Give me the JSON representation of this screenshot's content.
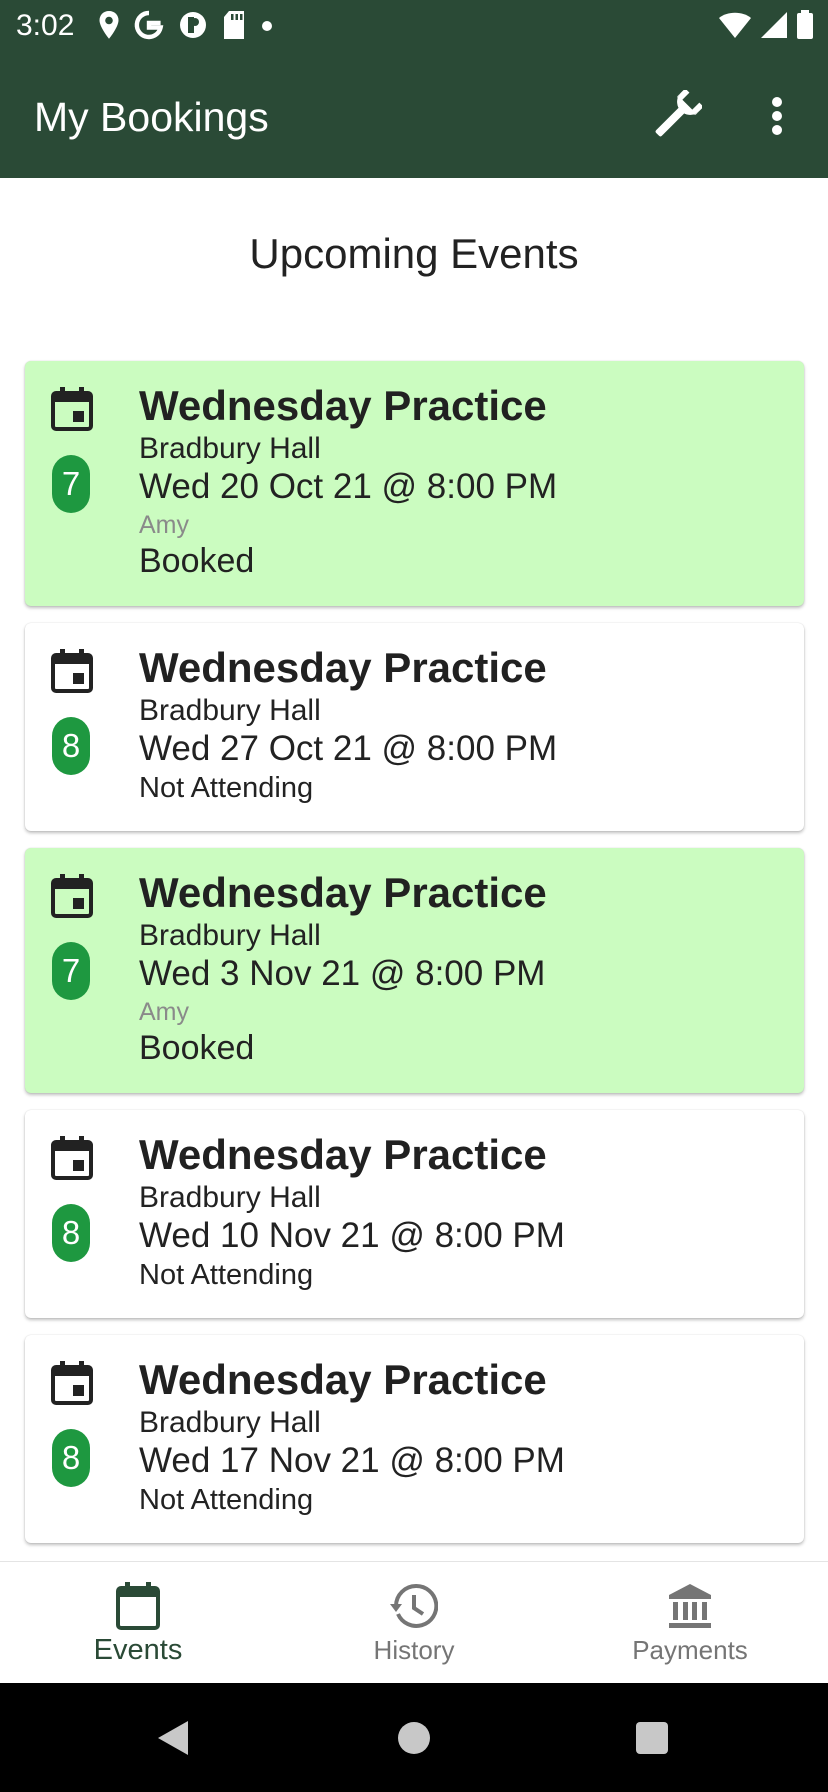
{
  "status_bar": {
    "time": "3:02"
  },
  "app_bar": {
    "title": "My Bookings"
  },
  "section_title": "Upcoming Events",
  "events": [
    {
      "count": "7",
      "title": "Wednesday Practice",
      "venue": "Bradbury Hall",
      "datetime": "Wed 20 Oct 21 @ 8:00 PM",
      "attendee": "Amy",
      "status": "Booked"
    },
    {
      "count": "8",
      "title": "Wednesday Practice",
      "venue": "Bradbury Hall",
      "datetime": "Wed 27 Oct 21 @ 8:00 PM",
      "status": "Not Attending"
    },
    {
      "count": "7",
      "title": "Wednesday Practice",
      "venue": "Bradbury Hall",
      "datetime": "Wed 3 Nov 21 @ 8:00 PM",
      "attendee": "Amy",
      "status": "Booked"
    },
    {
      "count": "8",
      "title": "Wednesday Practice",
      "venue": "Bradbury Hall",
      "datetime": "Wed 10 Nov 21 @ 8:00 PM",
      "status": "Not Attending"
    },
    {
      "count": "8",
      "title": "Wednesday Practice",
      "venue": "Bradbury Hall",
      "datetime": "Wed 17 Nov 21 @ 8:00 PM",
      "status": "Not Attending"
    }
  ],
  "bottom_nav": [
    {
      "label": "Events",
      "icon": "calendar-icon",
      "active": true
    },
    {
      "label": "History",
      "icon": "history-icon",
      "active": false
    },
    {
      "label": "Payments",
      "icon": "bank-icon",
      "active": false
    }
  ],
  "colors": {
    "app_bar": "#2a4a36",
    "booked_card": "#cbfcc0",
    "count_badge": "#1e9840"
  }
}
